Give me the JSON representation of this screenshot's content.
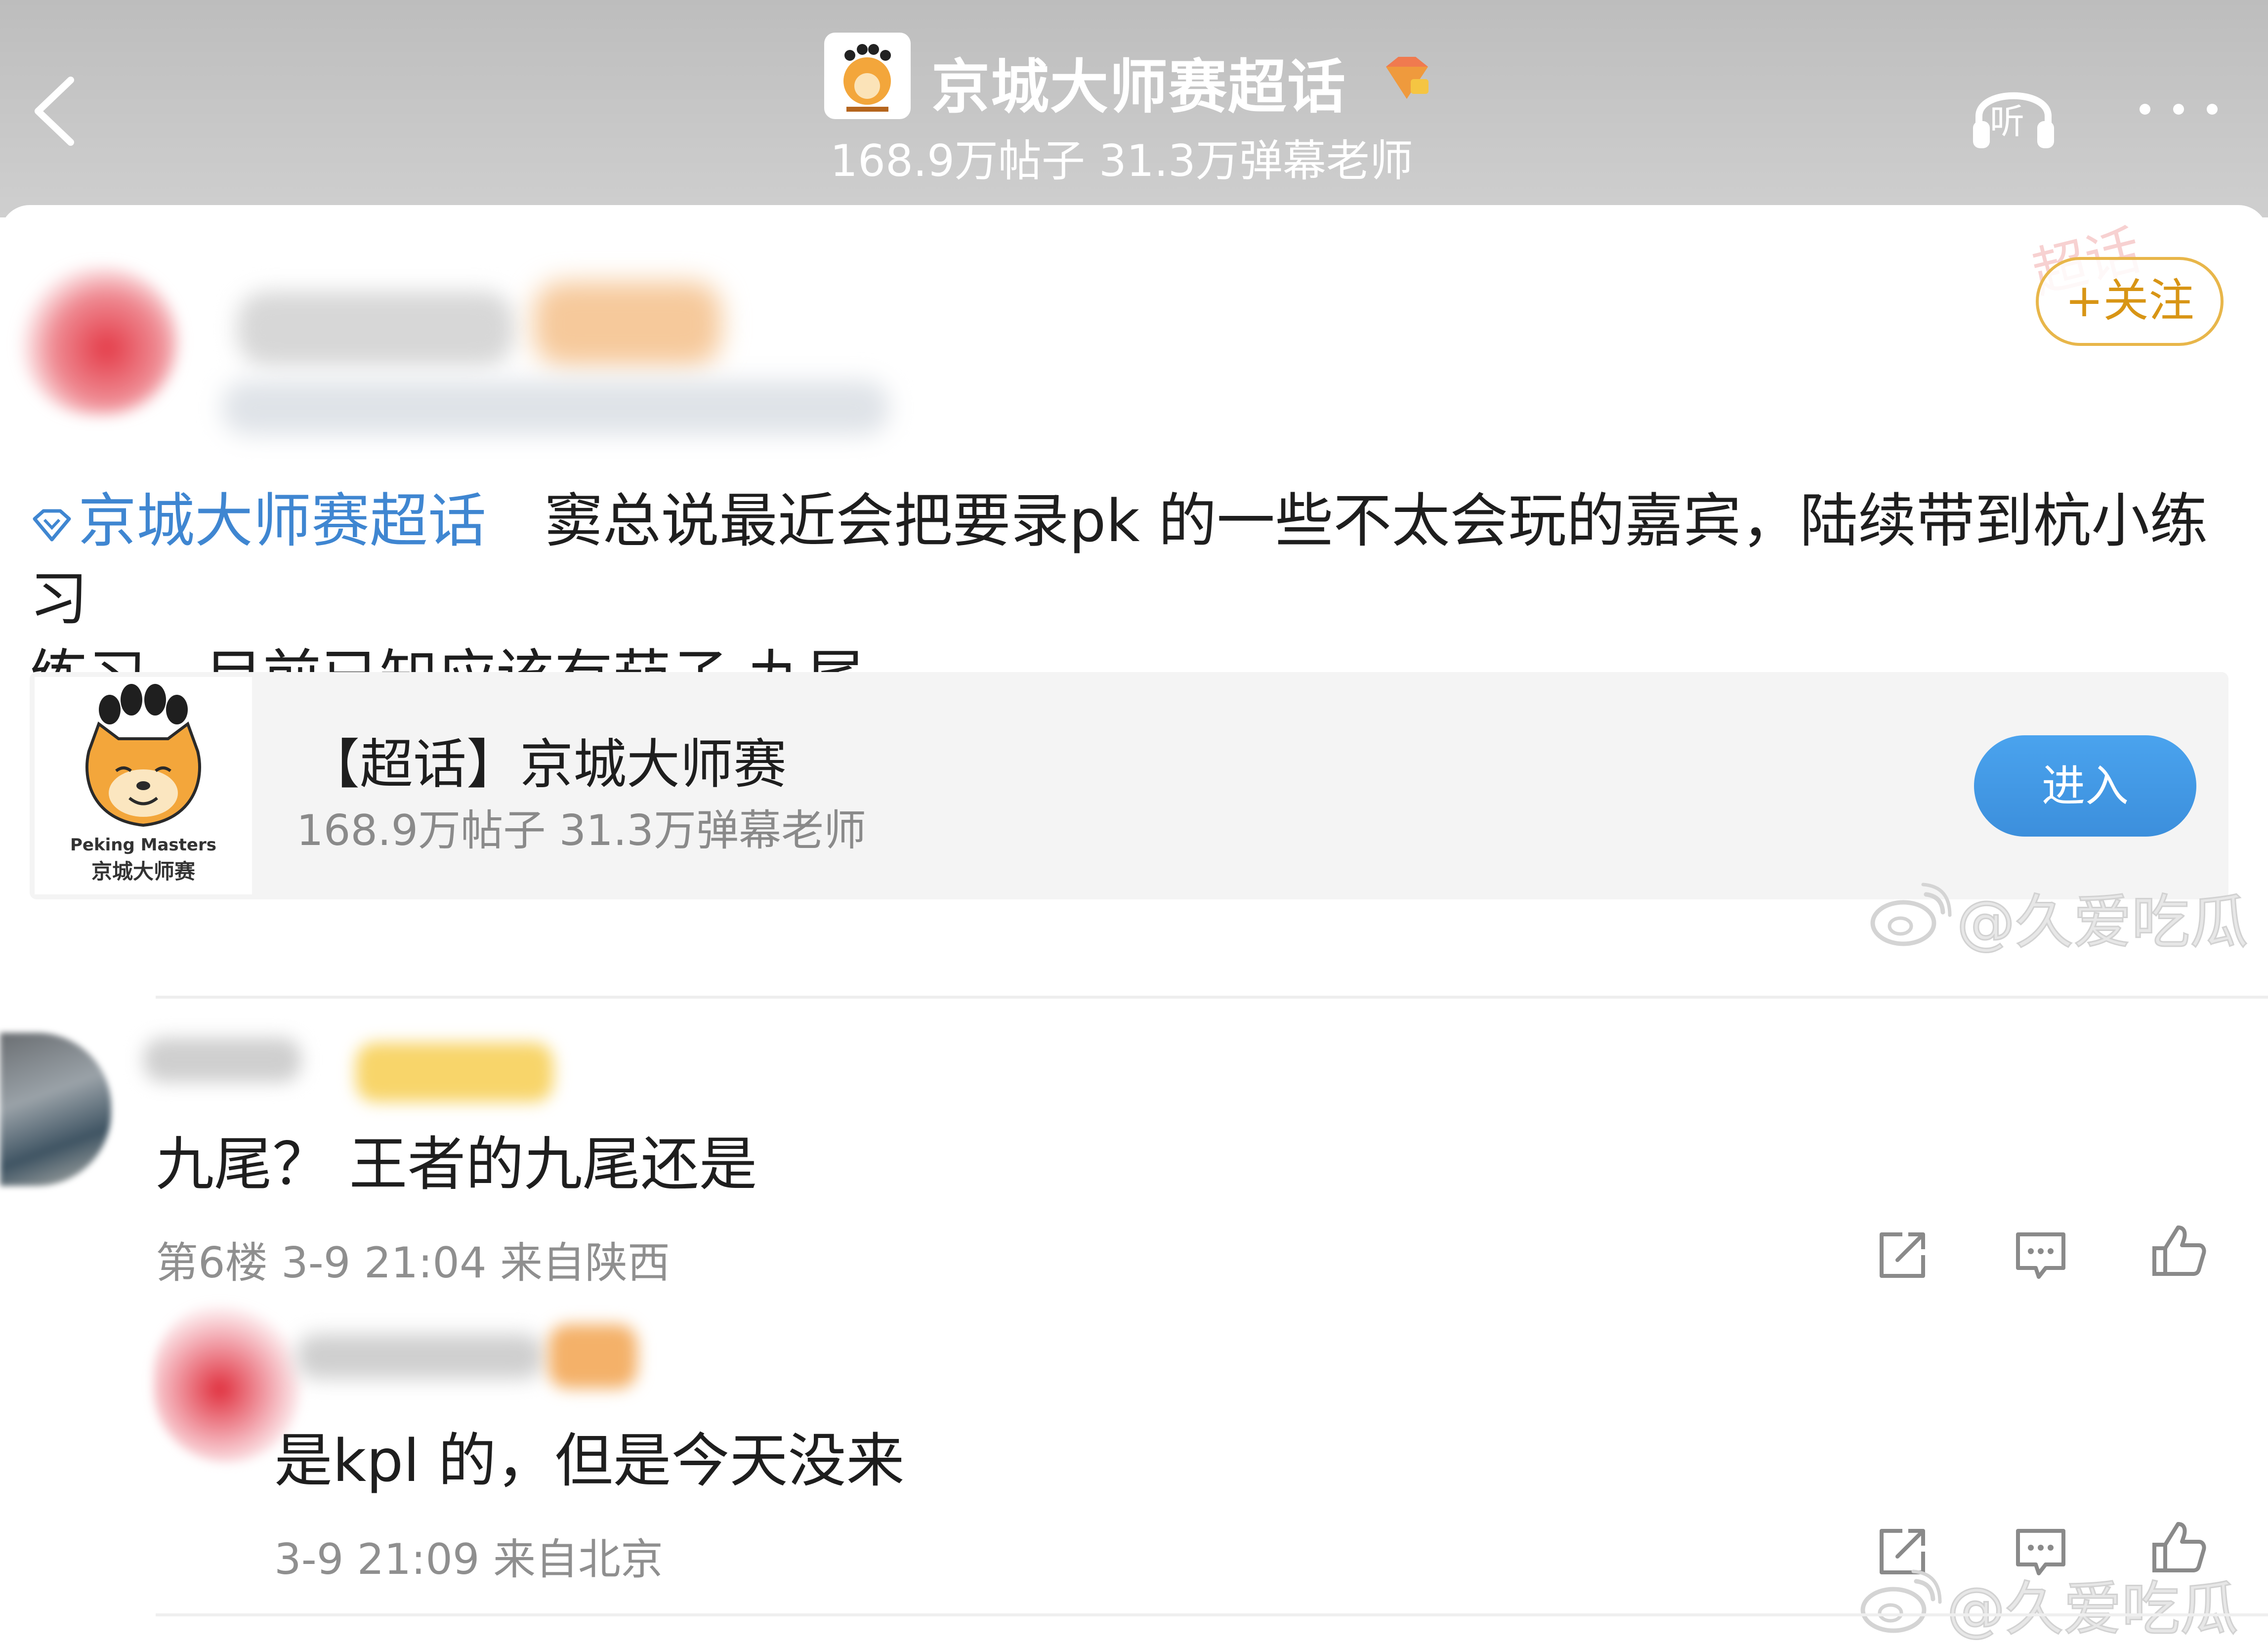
{
  "header": {
    "title": "京城大师赛超话",
    "stats": "168.9万帖子 31.3万弹幕老师",
    "listen_label": "听"
  },
  "post": {
    "follow_label": "+关注",
    "topic_link": "京城大师赛超话",
    "body_line1": "窦总说最近会把要录pk 的一些不太会玩的嘉宾，陆续带到杭小练习",
    "body_line2": "练习，目前已知应该有茄子 九尾",
    "decoration_text": "超话"
  },
  "topic_card": {
    "title": "【超话】京城大师赛",
    "stats": "168.9万帖子 31.3万弹幕老师",
    "logo_en": "Peking Masters",
    "logo_cn": "京城大师赛",
    "enter_label": "进入"
  },
  "watermark": "@久爱吃瓜",
  "comments": [
    {
      "text": "九尾？ 王者的九尾还是",
      "meta": "第6楼 3-9 21:04 来自陕西"
    },
    {
      "text": "是kpl 的，但是今天没来",
      "meta": "3-9 21:09 来自北京"
    }
  ],
  "colors": {
    "link_blue": "#3f86d1",
    "follow_gold": "#d89515",
    "enter_blue": "#3c8fdc",
    "meta_gray": "#8f8f8f"
  },
  "icons": {
    "back": "chevron-left-icon",
    "listen": "headphones-icon",
    "more": "more-dots-icon",
    "share": "share-icon",
    "comment": "comment-icon",
    "like": "thumbs-up-icon"
  }
}
